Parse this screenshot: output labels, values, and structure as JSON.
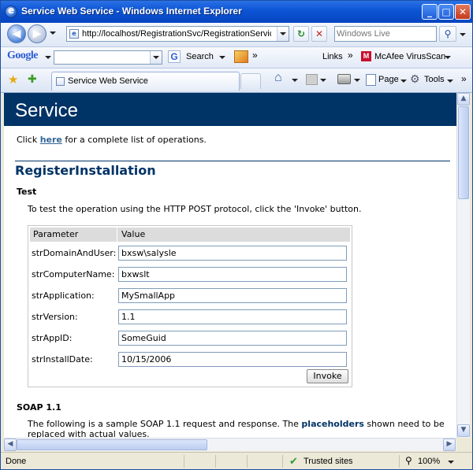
{
  "window": {
    "title": "Service Web Service - Windows Internet Explorer"
  },
  "nav": {
    "back_glyph": "◀",
    "forward_glyph": "▶",
    "url": "http://localhost/RegistrationSvc/RegistrationService.as",
    "refresh_glyph": "↻",
    "stop_glyph": "✕",
    "search_placeholder": "Windows Live",
    "search_glyph": "⚲"
  },
  "google_toolbar": {
    "logo": "Google",
    "search_button": "Search",
    "more_chevron": "»",
    "links": "Links",
    "mcafee": "McAfee VirusScan"
  },
  "tabs": {
    "favorites_glyph": "★",
    "add_favorites_glyph": "✚",
    "active_tab": "Service Web Service",
    "home_glyph": "⌂",
    "page_menu": "Page",
    "tools_menu": "Tools"
  },
  "page": {
    "banner_title": "Service",
    "intro_prefix": "Click ",
    "intro_link": "here",
    "intro_suffix": " for a complete list of operations.",
    "operation_title": "RegisterInstallation",
    "test_heading": "Test",
    "test_description": "To test the operation using the HTTP POST protocol, click the 'Invoke' button.",
    "form": {
      "col_parameter": "Parameter",
      "col_value": "Value",
      "rows": [
        {
          "label": "strDomainAndUser:",
          "value": "bxsw\\salysle"
        },
        {
          "label": "strComputerName:",
          "value": "bxwslt"
        },
        {
          "label": "strApplication:",
          "value": "MySmallApp"
        },
        {
          "label": "strVersion:",
          "value": "1.1"
        },
        {
          "label": "strAppID:",
          "value": "SomeGuid"
        },
        {
          "label": "strInstallDate:",
          "value": "10/15/2006"
        }
      ],
      "invoke_label": "Invoke"
    },
    "soap_heading": "SOAP 1.1",
    "soap_desc_prefix": "The following is a sample SOAP 1.1 request and response. The ",
    "soap_desc_bold": "placeholders",
    "soap_desc_suffix": " shown need to be replaced with actual values."
  },
  "status": {
    "left": "Done",
    "zone": "Trusted sites",
    "zoom": "100%"
  },
  "colors": {
    "banner": "#003366",
    "heading": "#003366",
    "link": "#336699"
  }
}
